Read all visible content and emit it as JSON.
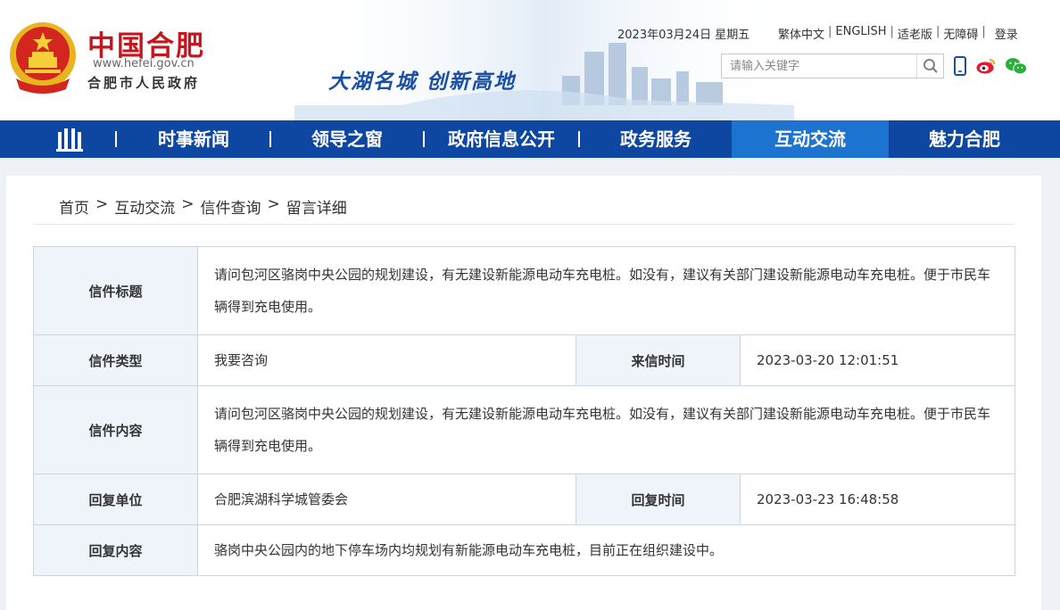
{
  "header": {
    "site_name": "中国合肥",
    "site_url": "www.hefei.gov.cn",
    "site_sub": "合肥市人民政府",
    "slogan": "大湖名城  创新高地",
    "date": "2023年03月24日 星期五",
    "top_links": [
      "繁体中文",
      "ENGLISH",
      "适老版",
      "无障碍",
      "登录"
    ],
    "search_placeholder": "请输入关键字"
  },
  "nav": {
    "items": [
      "时事新闻",
      "领导之窗",
      "政府信息公开",
      "政务服务",
      "互动交流",
      "魅力合肥"
    ],
    "active": "互动交流"
  },
  "breadcrumb": [
    "首页",
    "互动交流",
    "信件查询",
    "留言详细"
  ],
  "letter": {
    "title_label": "信件标题",
    "title": "请问包河区骆岗中央公园的规划建设，有无建设新能源电动车充电桩。如没有，建议有关部门建设新能源电动车充电桩。便于市民车辆得到充电使用。",
    "type_label": "信件类型",
    "type": "我要咨询",
    "time_label": "来信时间",
    "time": "2023-03-20 12:01:51",
    "content_label": "信件内容",
    "content": "请问包河区骆岗中央公园的规划建设，有无建设新能源电动车充电桩。如没有，建议有关部门建设新能源电动车充电桩。便于市民车辆得到充电使用。",
    "reply_unit_label": "回复单位",
    "reply_unit": "合肥滨湖科学城管委会",
    "reply_time_label": "回复时间",
    "reply_time": "2023-03-23 16:48:58",
    "reply_content_label": "回复内容",
    "reply_content": "骆岗中央公园内的地下停车场内均规划有新能源电动车充电桩，目前正在组织建设中。"
  },
  "colors": {
    "brand_red": "#c4161c",
    "nav_blue": "#0e47a1",
    "nav_active": "#1d74d0",
    "label_bg": "#eff4fb"
  },
  "icons": [
    "national-emblem-icon",
    "search-icon",
    "mobile-icon",
    "weibo-icon",
    "wechat-icon",
    "home-building-icon"
  ]
}
